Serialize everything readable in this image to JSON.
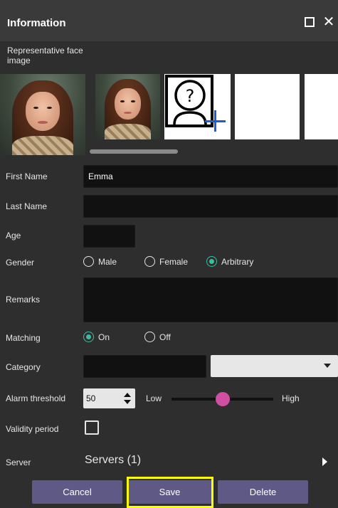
{
  "window": {
    "title": "Information"
  },
  "face_section": {
    "label": "Representative face image"
  },
  "fields": {
    "first_name": {
      "label": "First Name",
      "value": "Emma"
    },
    "last_name": {
      "label": "Last Name",
      "value": ""
    },
    "age": {
      "label": "Age",
      "value": ""
    },
    "gender": {
      "label": "Gender",
      "options": [
        "Male",
        "Female",
        "Arbitrary"
      ],
      "selected": "Arbitrary"
    },
    "remarks": {
      "label": "Remarks",
      "value": ""
    },
    "matching": {
      "label": "Matching",
      "options": [
        "On",
        "Off"
      ],
      "selected": "On"
    },
    "category": {
      "label": "Category",
      "value": "",
      "select_value": ""
    },
    "alarm_threshold": {
      "label": "Alarm threshold",
      "value": "50",
      "low_label": "Low",
      "high_label": "High",
      "slider_level": 0.5
    },
    "validity_period": {
      "label": "Validity period",
      "checked": false
    },
    "server": {
      "label": "Server",
      "value": "Servers (1)"
    }
  },
  "buttons": {
    "cancel": "Cancel",
    "save": "Save",
    "delete": "Delete"
  },
  "colors": {
    "accent_radio": "#3ebca3",
    "slider_thumb": "#d04fa3",
    "button": "#5e5a85",
    "highlight": "#ffff00",
    "add_icon": "#1e5bd6"
  },
  "icons": [
    "maximize-icon",
    "close-icon",
    "add-face-icon",
    "spin-up-icon",
    "spin-down-icon",
    "dropdown-arrow-icon",
    "expand-arrow-icon"
  ]
}
